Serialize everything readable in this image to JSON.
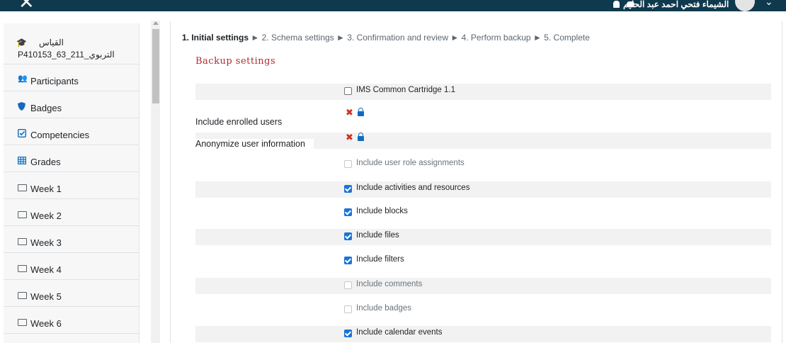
{
  "topbar": {
    "user_name": "الشيماء فتحي احمد عبد الحليم"
  },
  "sidebar": {
    "course": {
      "line1": "القياس",
      "line2": "P410153_63_211_التربوي"
    },
    "items": [
      {
        "label": "Participants",
        "icon": "users-icon"
      },
      {
        "label": "Badges",
        "icon": "shield-icon"
      },
      {
        "label": "Competencies",
        "icon": "check-square-icon"
      },
      {
        "label": "Grades",
        "icon": "table-icon"
      },
      {
        "label": "Week 1",
        "icon": "folder-icon"
      },
      {
        "label": "Week 2",
        "icon": "folder-icon"
      },
      {
        "label": "Week 3",
        "icon": "folder-icon"
      },
      {
        "label": "Week 4",
        "icon": "folder-icon"
      },
      {
        "label": "Week 5",
        "icon": "folder-icon"
      },
      {
        "label": "Week 6",
        "icon": "folder-icon"
      }
    ]
  },
  "steps": {
    "s1": "1. Initial settings",
    "s2": "2. Schema settings",
    "s3": "3. Confirmation and review",
    "s4": "4. Perform backup",
    "s5": "5. Complete",
    "separator": "►"
  },
  "section_title": "Backup settings",
  "settings": [
    {
      "label": "",
      "option": "IMS Common Cartridge 1.1",
      "state": "unchecked"
    },
    {
      "label": "Include enrolled users",
      "option": "",
      "state": "locked-no"
    },
    {
      "label": "Anonymize user information",
      "option": "",
      "state": "locked-no"
    },
    {
      "label": "",
      "option": "Include user role assignments",
      "state": "disabled"
    },
    {
      "label": "",
      "option": "Include activities and resources",
      "state": "checked"
    },
    {
      "label": "",
      "option": "Include blocks",
      "state": "checked"
    },
    {
      "label": "",
      "option": "Include files",
      "state": "checked"
    },
    {
      "label": "",
      "option": "Include filters",
      "state": "checked"
    },
    {
      "label": "",
      "option": "Include comments",
      "state": "disabled"
    },
    {
      "label": "",
      "option": "Include badges",
      "state": "disabled"
    },
    {
      "label": "",
      "option": "Include calendar events",
      "state": "checked"
    }
  ],
  "colors": {
    "topbar": "#0f3a4e",
    "checkbox_checked": "#1a73d8",
    "section_title": "#b0292e",
    "x_mark": "#ca3120",
    "lock": "#0f6cbf"
  }
}
